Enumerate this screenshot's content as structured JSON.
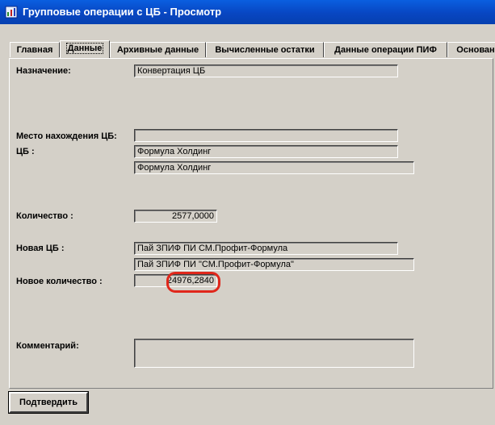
{
  "window": {
    "title": "Групповые операции с ЦБ - Просмотр"
  },
  "tabs": [
    {
      "label": "Главная",
      "active": false
    },
    {
      "label": "Данные",
      "active": true
    },
    {
      "label": "Архивные данные",
      "active": false
    },
    {
      "label": "Вычисленные остатки",
      "active": false
    },
    {
      "label": "Данные операции ПИФ",
      "active": false
    },
    {
      "label": "Основан",
      "active": false
    }
  ],
  "form": {
    "purpose_label": "Назначение:",
    "purpose_value": "Конвертация ЦБ",
    "location_label": "Место нахождения ЦБ:",
    "location_value": "",
    "security_label": "ЦБ :",
    "security_value": "Формула Холдинг",
    "security_fullname": "Формула Холдинг",
    "quantity_label": "Количество :",
    "quantity_value": "2577,0000",
    "new_security_label": "Новая ЦБ :",
    "new_security_value": "Пай ЗПИФ ПИ СМ.Профит-Формула",
    "new_security_fullname": "Пай ЗПИФ ПИ \"СМ.Профит-Формула\"",
    "new_quantity_label": "Новое количество :",
    "new_quantity_value": "24976,2840",
    "comment_label": "Комментарий:",
    "comment_value": ""
  },
  "buttons": {
    "confirm_label": "Подтвердить"
  },
  "colors": {
    "title_bar": "#0846c2",
    "dialog_bg": "#d4d0c8",
    "highlight": "#e0271b"
  },
  "icons": {
    "window": "app-window-icon"
  }
}
